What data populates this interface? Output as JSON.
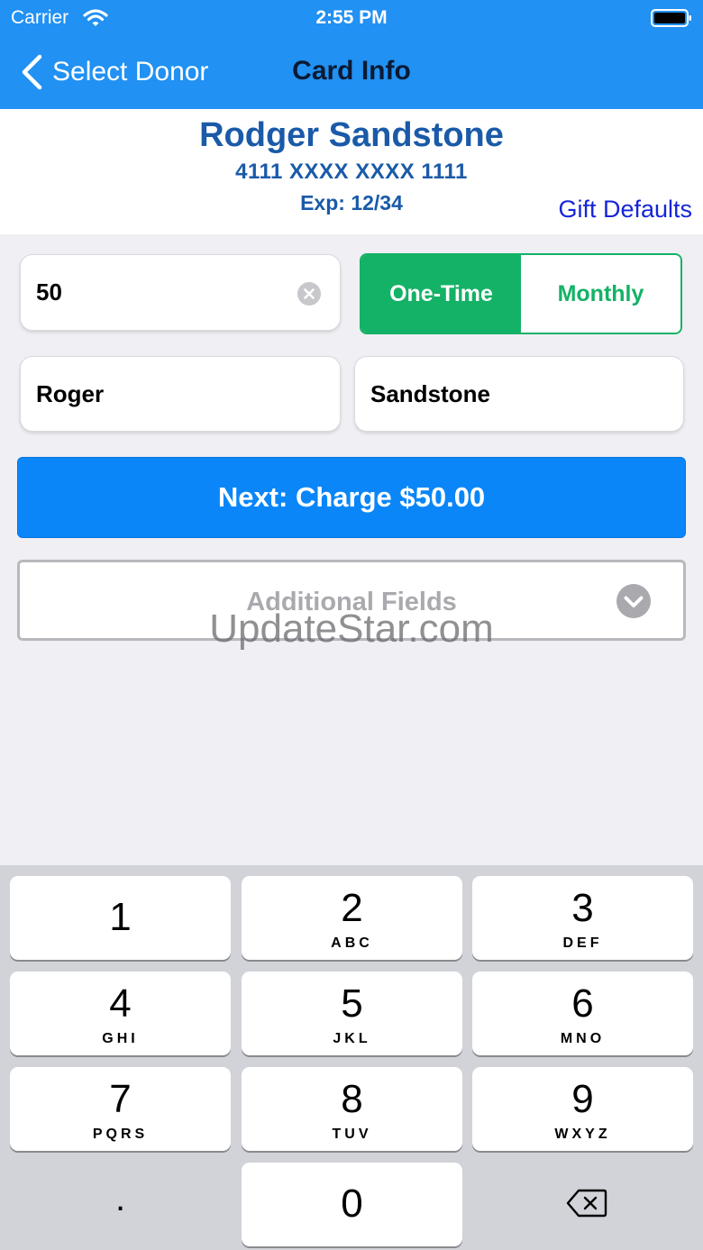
{
  "status_bar": {
    "carrier": "Carrier",
    "time": "2:55 PM"
  },
  "nav": {
    "back_label": "Select Donor",
    "title": "Card Info"
  },
  "donor": {
    "name": "Rodger Sandstone",
    "card_number": "4111 XXXX XXXX 1111",
    "expiration": "Exp: 12/34",
    "gift_defaults_label": "Gift Defaults"
  },
  "form": {
    "amount": "50",
    "frequency": {
      "one_time": "One-Time",
      "monthly": "Monthly",
      "selected": "One-Time"
    },
    "first_name": "Roger",
    "last_name": "Sandstone",
    "charge_button": "Next: Charge $50.00",
    "additional_fields": "Additional Fields"
  },
  "watermark": "UpdateStar.com",
  "keypad": {
    "keys": [
      {
        "digit": "1",
        "letters": ""
      },
      {
        "digit": "2",
        "letters": "ABC"
      },
      {
        "digit": "3",
        "letters": "DEF"
      },
      {
        "digit": "4",
        "letters": "GHI"
      },
      {
        "digit": "5",
        "letters": "JKL"
      },
      {
        "digit": "6",
        "letters": "MNO"
      },
      {
        "digit": "7",
        "letters": "PQRS"
      },
      {
        "digit": "8",
        "letters": "TUV"
      },
      {
        "digit": "9",
        "letters": "WXYZ"
      },
      {
        "digit": "0",
        "letters": ""
      }
    ],
    "decimal": "."
  },
  "colors": {
    "header": "#2191f3",
    "donor_text": "#1a5aa8",
    "accent_green": "#14b266",
    "charge_button": "#0a86f8",
    "gift_defaults": "#1525d8"
  }
}
